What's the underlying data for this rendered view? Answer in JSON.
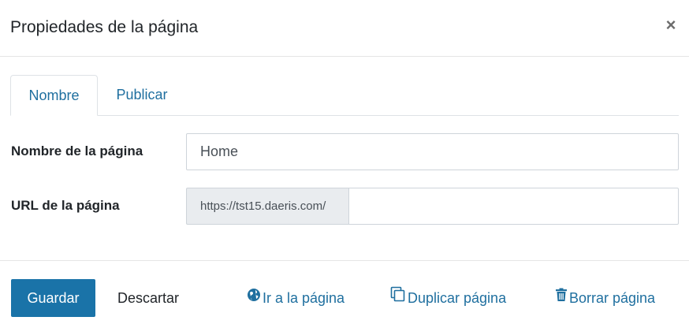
{
  "header": {
    "title": "Propiedades de la página",
    "close_label": "×"
  },
  "tabs": [
    {
      "label": "Nombre",
      "active": true
    },
    {
      "label": "Publicar",
      "active": false
    }
  ],
  "form": {
    "name_label": "Nombre de la página",
    "name_value": "Home",
    "url_label": "URL de la página",
    "url_prefix": "https://tst15.daeris.com/",
    "url_value": ""
  },
  "footer": {
    "save_label": "Guardar",
    "discard_label": "Descartar",
    "goto_label": "Ir a la página",
    "duplicate_label": "Duplicar página",
    "delete_label": "Borrar página"
  },
  "icons": {
    "goto": "globe-icon",
    "duplicate": "copy-icon",
    "delete": "trash-icon"
  },
  "colors": {
    "primary": "#1a73a8",
    "link": "#1f6f9f",
    "addon_bg": "#e9ecef"
  }
}
